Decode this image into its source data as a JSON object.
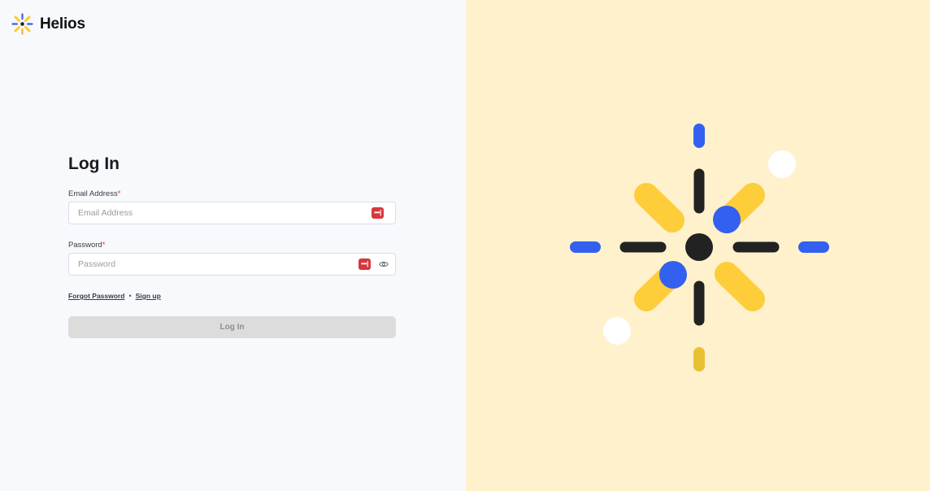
{
  "brand": {
    "name": "Helios",
    "logo_icon": "helios-sunburst-icon"
  },
  "login": {
    "title": "Log In",
    "email": {
      "label": "Email Address",
      "required_mark": "*",
      "placeholder": "Email Address",
      "value": "",
      "manager_icon": "password-manager-icon",
      "manager_glyph": "•••|"
    },
    "password": {
      "label": "Password",
      "required_mark": "*",
      "placeholder": "Password",
      "value": "",
      "manager_icon": "password-manager-icon",
      "manager_glyph": "•••|",
      "toggle_icon": "eye-icon"
    },
    "links": {
      "forgot_password": "Forgot Password",
      "separator": "•",
      "sign_up": "Sign up"
    },
    "submit_label": "Log In",
    "submit_enabled": false
  },
  "colors": {
    "left_background": "#f8f9fd",
    "right_background": "#fef1cc",
    "accent_yellow": "#fecd3a",
    "accent_blue": "#3360f0",
    "dark": "#222222",
    "required": "#d0343b",
    "password_manager": "#d8373c",
    "button_disabled_bg": "#dcdcdc",
    "button_disabled_text": "#8e8e8e"
  },
  "illustration": {
    "name": "sunburst-illustration"
  }
}
